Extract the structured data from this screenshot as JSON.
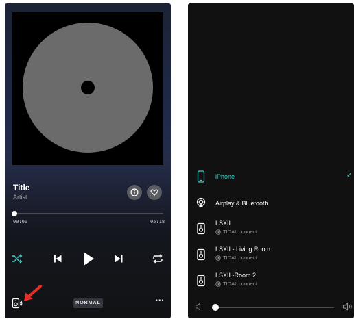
{
  "player": {
    "track_title": "Title",
    "track_artist": "Artist",
    "elapsed": "00:00",
    "duration": "05:18",
    "progress_fraction": 0.0,
    "quality_label": "NORMAL",
    "more_label": "···",
    "accent_color": "#3fd1c8",
    "icons": [
      "info-icon",
      "heart-icon",
      "shuffle-icon",
      "previous-icon",
      "play-icon",
      "next-icon",
      "repeat-icon",
      "speaker-output-icon"
    ]
  },
  "annotation": {
    "arrow_color": "#e5312a"
  },
  "devices": {
    "items": [
      {
        "name": "iPhone",
        "subtitle": "",
        "selected": true,
        "icon": "phone-icon"
      },
      {
        "name": "Airplay & Bluetooth",
        "subtitle": "",
        "selected": false,
        "icon": "airplay-icon"
      },
      {
        "name": "LSXII",
        "subtitle": "TIDAL connect",
        "selected": false,
        "icon": "speaker-icon"
      },
      {
        "name": "LSXII - Living Room",
        "subtitle": "TIDAL connect",
        "selected": false,
        "icon": "speaker-icon"
      },
      {
        "name": "LSXII -Room 2",
        "subtitle": "TIDAL connect",
        "selected": false,
        "icon": "speaker-icon"
      }
    ],
    "selected_mark": "✓",
    "volume_fraction": 0.0
  }
}
